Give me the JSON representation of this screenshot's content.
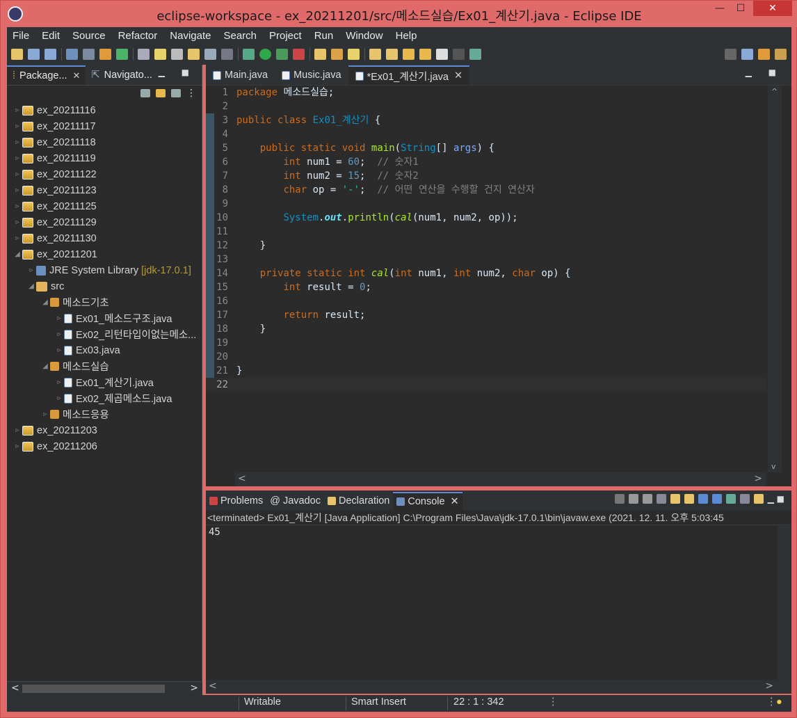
{
  "window": {
    "title": "eclipse-workspace - ex_20211201/src/메소드실습/Ex01_계산기.java - Eclipse IDE",
    "min": "—",
    "max": "☐",
    "close": "✕"
  },
  "menu": [
    "File",
    "Edit",
    "Source",
    "Refactor",
    "Navigate",
    "Search",
    "Project",
    "Run",
    "Window",
    "Help"
  ],
  "left_panel": {
    "tabs": [
      {
        "label": "Package...",
        "close": "✕"
      },
      {
        "label": "Navigato...",
        "close": ""
      }
    ],
    "tree": [
      {
        "label": "ex_20211116",
        "icon": "project",
        "depth": 0
      },
      {
        "label": "ex_20211117",
        "icon": "project",
        "depth": 0
      },
      {
        "label": "ex_20211118",
        "icon": "project",
        "depth": 0
      },
      {
        "label": "ex_20211119",
        "icon": "project",
        "depth": 0
      },
      {
        "label": "ex_20211122",
        "icon": "project",
        "depth": 0
      },
      {
        "label": "ex_20211123",
        "icon": "project",
        "depth": 0
      },
      {
        "label": "ex_20211125",
        "icon": "project",
        "depth": 0
      },
      {
        "label": "ex_20211129",
        "icon": "project",
        "depth": 0
      },
      {
        "label": "ex_20211130",
        "icon": "project",
        "depth": 0
      },
      {
        "label": "ex_20211201",
        "icon": "project",
        "depth": 0,
        "expanded": true
      },
      {
        "label": "JRE System Library",
        "extra": "[jdk-17.0.1]",
        "icon": "library",
        "depth": 1
      },
      {
        "label": "src",
        "icon": "src",
        "depth": 1,
        "expanded": true
      },
      {
        "label": "메소드기초",
        "icon": "package",
        "depth": 2,
        "expanded": true
      },
      {
        "label": "Ex01_메소드구조.java",
        "icon": "java",
        "depth": 3
      },
      {
        "label": "Ex02_리턴타입이없는메소...",
        "icon": "java",
        "depth": 3
      },
      {
        "label": "Ex03.java",
        "icon": "java",
        "depth": 3
      },
      {
        "label": "메소드실습",
        "icon": "package",
        "depth": 2,
        "expanded": true
      },
      {
        "label": "Ex01_계산기.java",
        "icon": "java",
        "depth": 3
      },
      {
        "label": "Ex02_제곱메소드.java",
        "icon": "java",
        "depth": 3
      },
      {
        "label": "메소드응용",
        "icon": "package",
        "depth": 2
      },
      {
        "label": "ex_20211203",
        "icon": "project",
        "depth": 0
      },
      {
        "label": "ex_20211206",
        "icon": "project",
        "depth": 0
      }
    ]
  },
  "editor": {
    "tabs": [
      {
        "label": "Main.java",
        "active": false
      },
      {
        "label": "Music.java",
        "active": false
      },
      {
        "label": "*Ex01_계산기.java",
        "active": true,
        "close": "✕"
      }
    ],
    "lines": [
      "package 메소드실습;",
      "",
      "public class Ex01_계산기 {",
      "",
      "    public static void main(String[] args) {",
      "        int num1 = 60;  // 숫자1",
      "        int num2 = 15;  // 숫자2",
      "        char op = '-';  // 어떤 연산을 수행할 건지 연산자",
      "",
      "        System.out.println(cal(num1, num2, op));",
      "",
      "    }",
      "",
      "    private static int cal(int num1, int num2, char op) {",
      "        int result = 0;",
      "",
      "        return result;",
      "    }",
      "",
      "",
      "}",
      ""
    ],
    "current_line": 20
  },
  "console": {
    "tabs": [
      {
        "label": "Problems",
        "active": false
      },
      {
        "label": "Javadoc",
        "active": false
      },
      {
        "label": "Declaration",
        "active": false
      },
      {
        "label": "Console",
        "active": true,
        "close": "✕"
      }
    ],
    "status": "<terminated> Ex01_계산기 [Java Application] C:\\Program Files\\Java\\jdk-17.0.1\\bin\\javaw.exe  (2021. 12. 11. 오후 5:03:45",
    "output": "45"
  },
  "statusbar": {
    "writable": "Writable",
    "insert": "Smart Insert",
    "position": "22 : 1 : 342"
  },
  "colors": {
    "frame": "#e06a6a",
    "editor_bg": "#2b2b2b",
    "keyword": "#cc6c1d",
    "class": "#1290c3",
    "number": "#6897bb",
    "comment": "#808080",
    "method": "#a7ec21"
  }
}
